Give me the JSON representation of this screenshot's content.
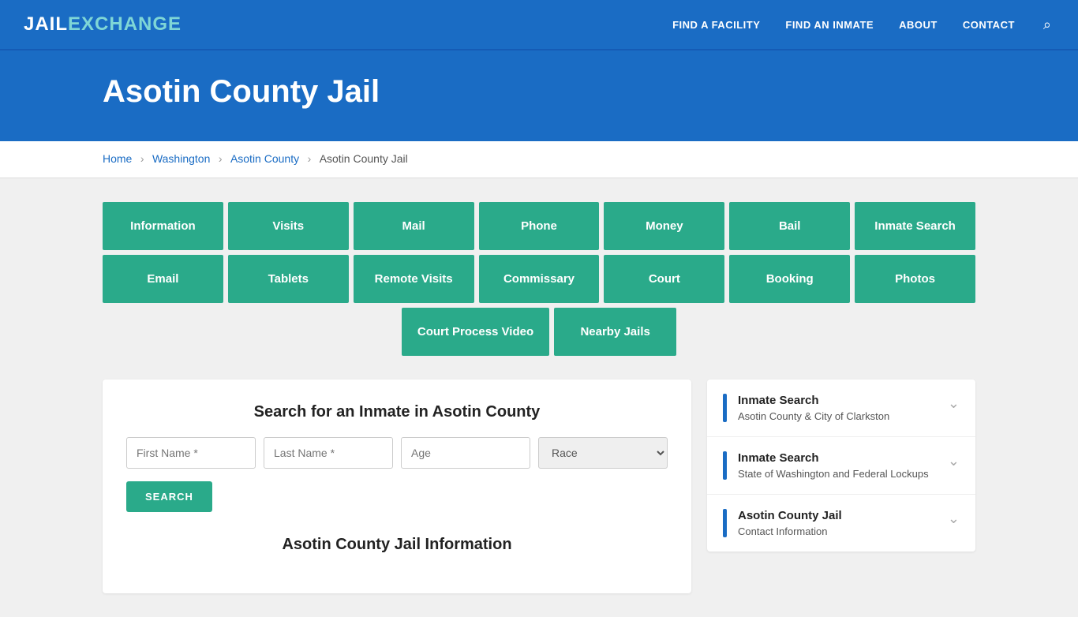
{
  "navbar": {
    "logo_jail": "JAIL",
    "logo_exchange": "EXCHANGE",
    "links": [
      {
        "id": "find-facility",
        "label": "FIND A FACILITY"
      },
      {
        "id": "find-inmate",
        "label": "FIND AN INMATE"
      },
      {
        "id": "about",
        "label": "ABOUT"
      },
      {
        "id": "contact",
        "label": "CONTACT"
      }
    ]
  },
  "hero": {
    "title": "Asotin County Jail"
  },
  "breadcrumb": {
    "home": "Home",
    "washington": "Washington",
    "asotin_county": "Asotin County",
    "current": "Asotin County Jail"
  },
  "nav_buttons_row1": [
    "Information",
    "Visits",
    "Mail",
    "Phone",
    "Money",
    "Bail",
    "Inmate Search"
  ],
  "nav_buttons_row2": [
    "Email",
    "Tablets",
    "Remote Visits",
    "Commissary",
    "Court",
    "Booking",
    "Photos"
  ],
  "nav_buttons_row3": [
    "Court Process Video",
    "Nearby Jails"
  ],
  "search": {
    "title": "Search for an Inmate in Asotin County",
    "first_name_placeholder": "First Name *",
    "last_name_placeholder": "Last Name *",
    "age_placeholder": "Age",
    "race_placeholder": "Race",
    "button_label": "SEARCH"
  },
  "section_title": "Asotin County Jail Information",
  "sidebar": {
    "items": [
      {
        "title": "Inmate Search",
        "subtitle": "Asotin County & City of Clarkston"
      },
      {
        "title": "Inmate Search",
        "subtitle": "State of Washington and Federal Lockups"
      },
      {
        "title": "Asotin County Jail",
        "subtitle": "Contact Information"
      }
    ]
  },
  "icons": {
    "search": "&#x2315;",
    "chevron_right": "›",
    "chevron_down": "&#8964;"
  }
}
